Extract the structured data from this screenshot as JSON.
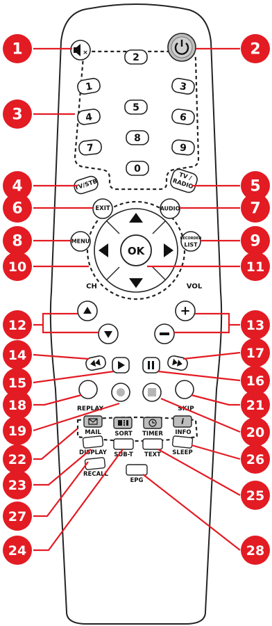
{
  "colors": {
    "callout": "#e31b23",
    "body_outline": "#222222",
    "power_fill": "#bdbdbd"
  },
  "digits": [
    "1",
    "2",
    "3",
    "4",
    "5",
    "6",
    "7",
    "8",
    "9",
    "0"
  ],
  "buttons": {
    "tv_stb": "TV/STB",
    "tv_radio_1": "TV /",
    "tv_radio_2": "RADIO",
    "exit": "EXIT",
    "audio": "AUDIO",
    "menu": "MENU",
    "recorded_1": "RECORDED",
    "recorded_2": "LIST",
    "ok": "OK",
    "ch": "CH",
    "vol": "VOL",
    "replay": "REPLAY",
    "skip": "SKIP",
    "mail": "MAIL",
    "sort": "SORT",
    "timer": "TIMER",
    "info": "INFO",
    "display": "DISPLAY",
    "sub_t": "SUB-T",
    "text": "TEXT",
    "sleep": "SLEEP",
    "recall": "RECALL",
    "epg": "EPG"
  },
  "callouts": [
    "1",
    "2",
    "3",
    "4",
    "5",
    "6",
    "7",
    "8",
    "9",
    "10",
    "11",
    "12",
    "13",
    "14",
    "15",
    "16",
    "17",
    "18",
    "19",
    "20",
    "21",
    "22",
    "23",
    "24",
    "25",
    "26",
    "27",
    "28"
  ],
  "icons": [
    "mute-icon",
    "power-icon",
    "arrow-up-icon",
    "arrow-down-icon",
    "arrow-left-icon",
    "arrow-right-icon",
    "rewind-icon",
    "play-icon",
    "pause-icon",
    "fast-forward-icon",
    "record-icon",
    "stop-icon",
    "mail-icon",
    "sort-icon",
    "timer-icon",
    "info-icon"
  ]
}
